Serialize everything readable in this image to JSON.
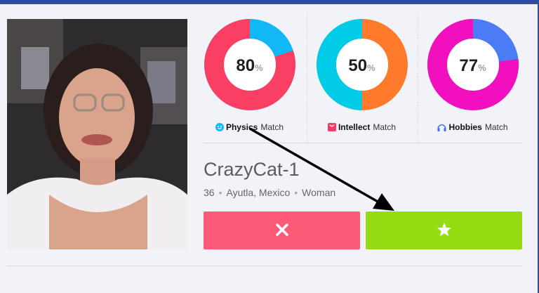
{
  "profile": {
    "name": "CrazyCat-1",
    "age": "36",
    "location": "Ayutla, Mexico",
    "gender": "Woman",
    "separator": "•"
  },
  "stats": [
    {
      "kind": "Physics",
      "suffix": "Match",
      "value": "80",
      "fraction": 0.8,
      "primary": "#fb3f63",
      "secondary": "#12b8f5",
      "icon": "smile-icon",
      "icon_color": "#12b8f5"
    },
    {
      "kind": "Intellect",
      "suffix": "Match",
      "value": "50",
      "fraction": 0.5,
      "primary": "#00cce8",
      "secondary": "#ff7a2a",
      "icon": "book-icon",
      "icon_color": "#f03c6a"
    },
    {
      "kind": "Hobbies",
      "suffix": "Match",
      "value": "77",
      "fraction": 0.77,
      "primary": "#f20fbd",
      "secondary": "#4c7cf5",
      "icon": "headphones-icon",
      "icon_color": "#3d6ff0"
    }
  ],
  "percent_symbol": "%",
  "actions": {
    "pass_icon": "close-icon",
    "like_icon": "star-icon"
  },
  "colors": {
    "topbar": "#2d4d9a",
    "pass": "#fd5a78",
    "like": "#95dd12"
  }
}
